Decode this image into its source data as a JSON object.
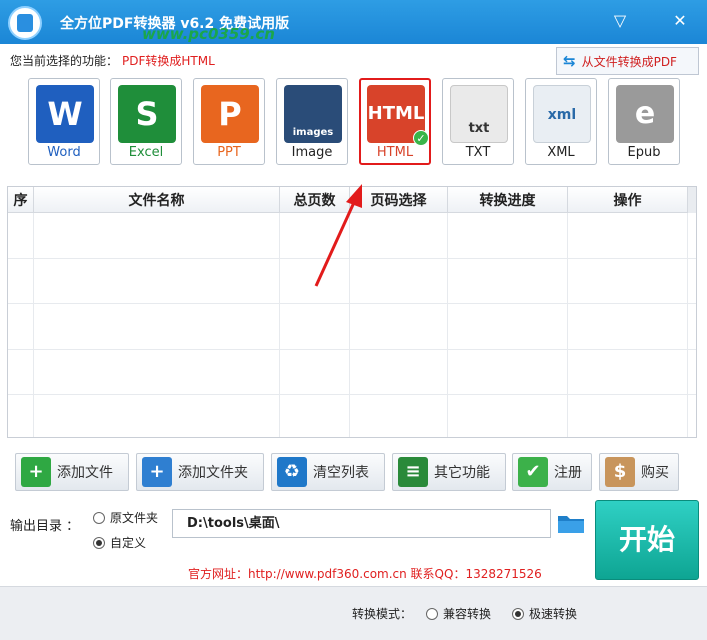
{
  "window": {
    "title": "全方位PDF转换器 v6.2 免费试用版",
    "watermark": "www.pc0359.cn",
    "minimize_glyph": "▽",
    "close_glyph": "✕"
  },
  "current_function": {
    "label": "您当前选择的功能：",
    "value": "PDF转换成HTML"
  },
  "to_pdf_button": "从文件转换成PDF",
  "formats": [
    {
      "label": "Word",
      "glyph": "W",
      "color": "#1f5fbf"
    },
    {
      "label": "Excel",
      "glyph": "S",
      "color": "#1f8e3a"
    },
    {
      "label": "PPT",
      "glyph": "P",
      "color": "#e8661f"
    },
    {
      "label": "Image",
      "glyph": "images",
      "color": "#2a4c78"
    },
    {
      "label": "HTML",
      "glyph": "HTML",
      "color": "#d8432a"
    },
    {
      "label": "TXT",
      "glyph": "txt",
      "color": "#eaeaea"
    },
    {
      "label": "XML",
      "glyph": "xml",
      "color": "#e9eef3"
    },
    {
      "label": "Epub",
      "glyph": "e",
      "color": "#9a9a9a"
    }
  ],
  "selected_format": "HTML",
  "table": {
    "columns": [
      "序",
      "文件名称",
      "总页数",
      "页码选择",
      "转换进度",
      "操作"
    ],
    "rows": []
  },
  "actions": [
    {
      "label": "添加文件",
      "icon": "add-file-icon",
      "glyph": "+",
      "color": "#2fa843"
    },
    {
      "label": "添加文件夹",
      "icon": "add-folder-icon",
      "glyph": "+",
      "color": "#2f7fd1"
    },
    {
      "label": "清空列表",
      "icon": "trash-icon",
      "glyph": "♻",
      "color": "#1f78c9"
    },
    {
      "label": "其它功能",
      "icon": "tools-icon",
      "glyph": "≡",
      "color": "#2a8a3a"
    },
    {
      "label": "注册",
      "icon": "register-check-icon",
      "glyph": "✔",
      "color": "#3cb14a"
    },
    {
      "label": "购买",
      "icon": "shopping-bag-icon",
      "glyph": "$",
      "color": "#c8955c"
    }
  ],
  "output": {
    "label": "输出目录 ：",
    "options": [
      "原文件夹",
      "自定义"
    ],
    "selected": "自定义",
    "path": "D:\\tools\\桌面\\"
  },
  "start_button": "开始",
  "website": "官方网址：http://www.pdf360.com.cn        联系QQ：1328271526",
  "mode": {
    "label": "转换模式：",
    "options": [
      "兼容转换",
      "极速转换"
    ],
    "selected": "极速转换"
  }
}
